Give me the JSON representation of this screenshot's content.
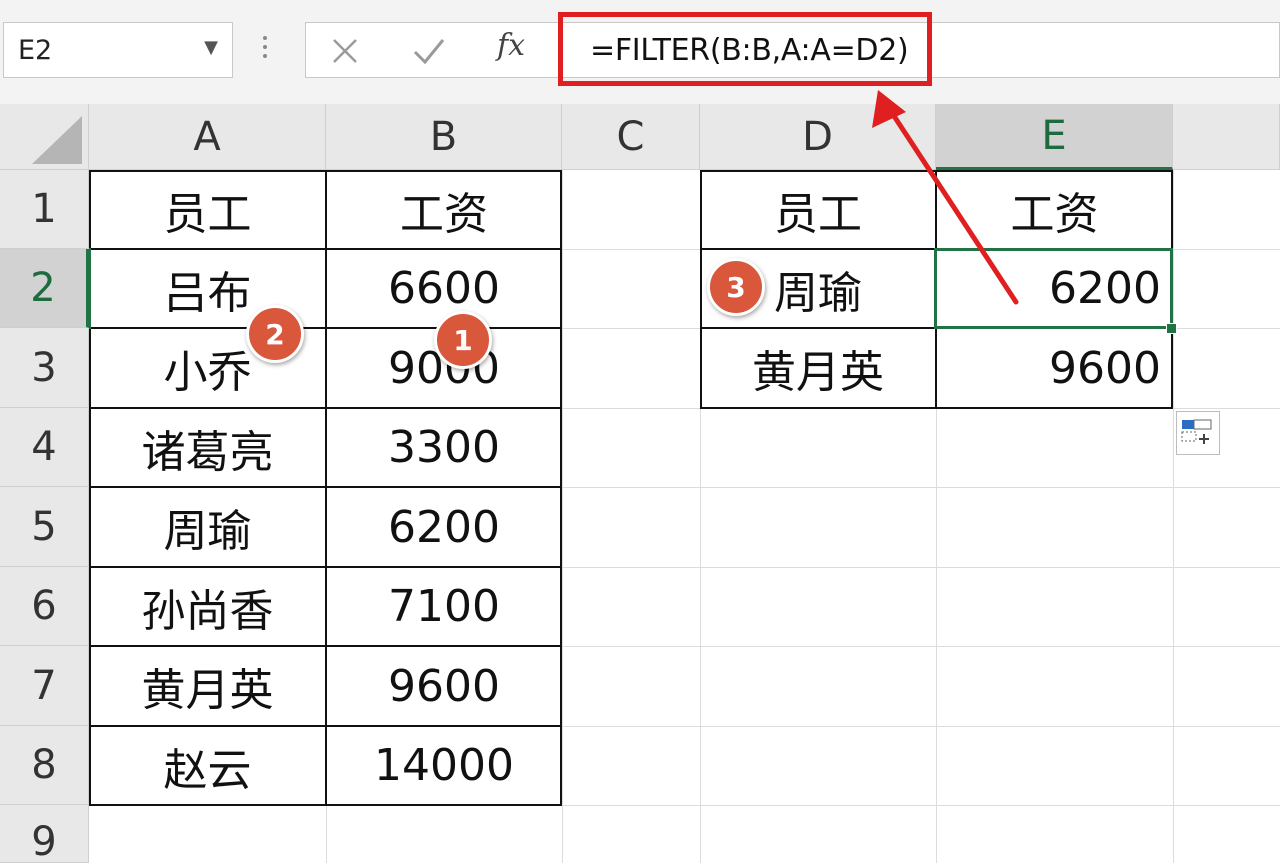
{
  "formula_bar": {
    "name_box": "E2",
    "fx_label": "fx",
    "formula": "=FILTER(B:B,A:A=D2)"
  },
  "columns": [
    "A",
    "B",
    "C",
    "D",
    "E"
  ],
  "rows": [
    "1",
    "2",
    "3",
    "4",
    "5",
    "6",
    "7",
    "8",
    "9"
  ],
  "source_table": [
    [
      "员工",
      "工资"
    ],
    [
      "吕布",
      "6600"
    ],
    [
      "小乔",
      "9000"
    ],
    [
      "诸葛亮",
      "3300"
    ],
    [
      "周瑜",
      "6200"
    ],
    [
      "孙尚香",
      "7100"
    ],
    [
      "黄月英",
      "9600"
    ],
    [
      "赵云",
      "14000"
    ]
  ],
  "result_table": [
    [
      "员工",
      "工资"
    ],
    [
      "周瑜",
      "6200"
    ],
    [
      "黄月英",
      "9600"
    ]
  ],
  "badges": [
    "1",
    "2",
    "3"
  ],
  "colors": {
    "selection": "#217346",
    "highlight": "#e02020",
    "badge": "#d9573b"
  }
}
